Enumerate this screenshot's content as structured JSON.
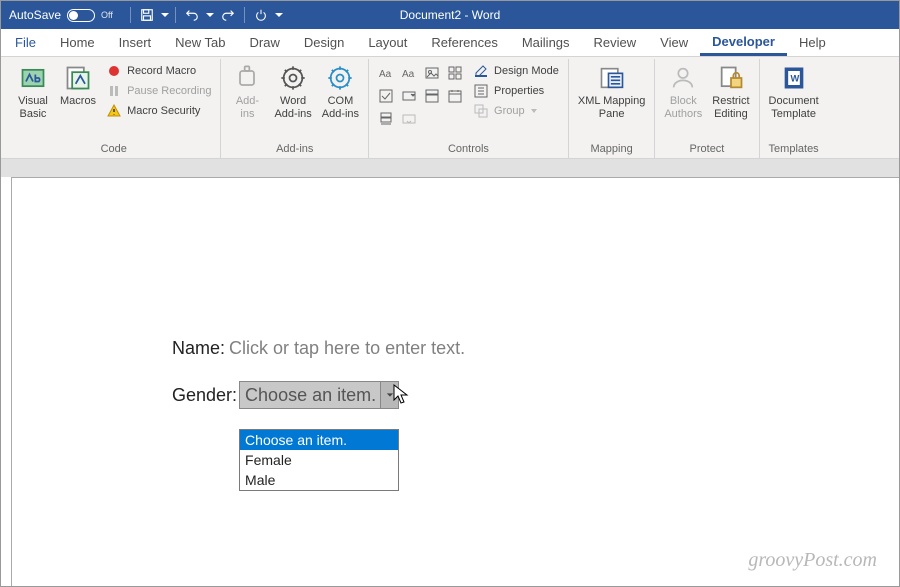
{
  "titlebar": {
    "autosave": "AutoSave",
    "autosave_state": "Off",
    "title": "Document2 - Word"
  },
  "tabs": {
    "file": "File",
    "home": "Home",
    "insert": "Insert",
    "newtab": "New Tab",
    "draw": "Draw",
    "design": "Design",
    "layout": "Layout",
    "references": "References",
    "mailings": "Mailings",
    "review": "Review",
    "view": "View",
    "developer": "Developer",
    "help": "Help"
  },
  "ribbon": {
    "code": {
      "label": "Code",
      "visual_basic": "Visual\nBasic",
      "macros": "Macros",
      "record": "Record Macro",
      "pause": "Pause Recording",
      "security": "Macro Security"
    },
    "addins": {
      "label": "Add-ins",
      "addins": "Add-\nins",
      "word_addins": "Word\nAdd-ins",
      "com_addins": "COM\nAdd-ins"
    },
    "controls": {
      "label": "Controls",
      "design_mode": "Design Mode",
      "properties": "Properties",
      "group": "Group"
    },
    "mapping": {
      "label": "Mapping",
      "xml_mapping": "XML Mapping\nPane"
    },
    "protect": {
      "label": "Protect",
      "block_authors": "Block\nAuthors",
      "restrict": "Restrict\nEditing"
    },
    "templates": {
      "label": "Templates",
      "doc_template": "Document\nTemplate"
    }
  },
  "document": {
    "name_label": "Name:",
    "name_placeholder": "Click or tap here to enter text.",
    "gender_label": "Gender:",
    "dropdown_selected": "Choose an item.",
    "options": [
      "Choose an item.",
      "Female",
      "Male"
    ]
  },
  "watermark": "groovyPost.com"
}
